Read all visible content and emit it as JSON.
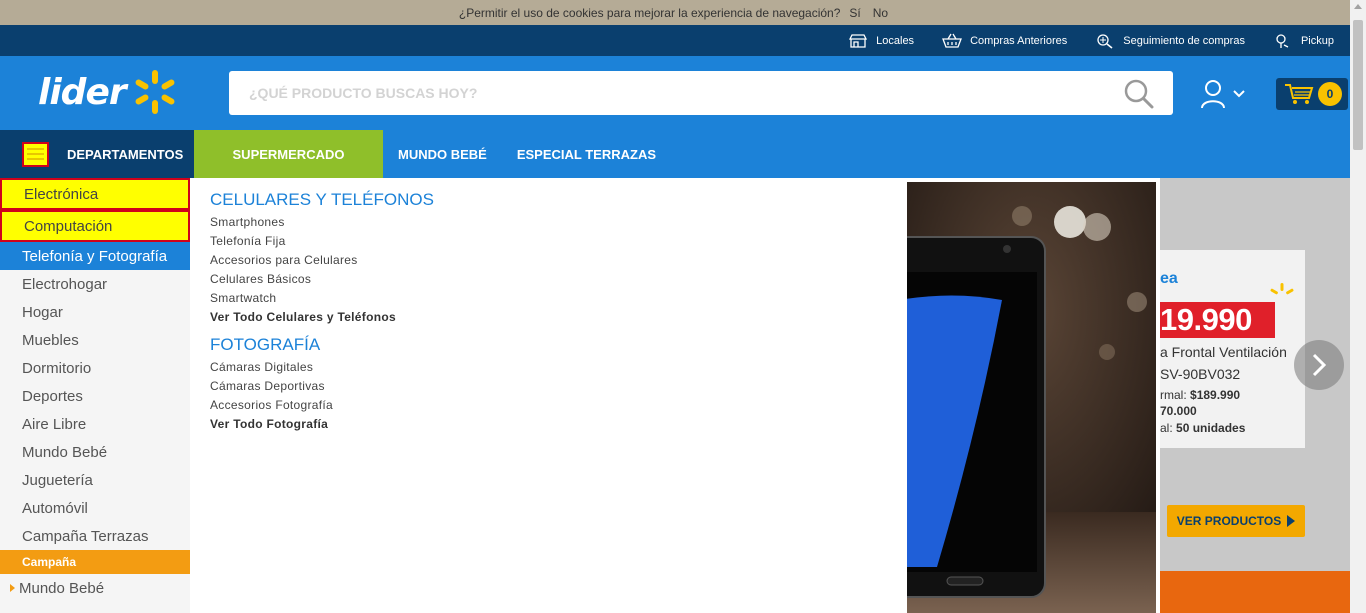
{
  "cookie": {
    "question": "¿Permitir el uso de cookies para mejorar la experiencia de navegación?",
    "yes": "Sí",
    "no": "No"
  },
  "utility": {
    "locales": "Locales",
    "compras": "Compras Anteriores",
    "seguimiento": "Seguimiento de compras",
    "pickup": "Pickup"
  },
  "header": {
    "logo": "lider",
    "search_placeholder": "¿QUÉ PRODUCTO BUSCAS HOY?",
    "cart_count": "0"
  },
  "nav": {
    "departamentos": "DEPARTAMENTOS",
    "supermercado": "SUPERMERCADO",
    "mundo_bebe": "MUNDO BEBÉ",
    "terrazas": "ESPECIAL TERRAZAS"
  },
  "sidebar": {
    "items": [
      "Electrónica",
      "Computación",
      "Telefonía y Fotografía",
      "Electrohogar",
      "Hogar",
      "Muebles",
      "Dormitorio",
      "Deportes",
      "Aire Libre",
      "Mundo Bebé",
      "Juguetería",
      "Automóvil",
      "Campaña Terrazas"
    ],
    "campaign_label": "Campaña",
    "campaign_items": [
      "Mundo Bebé"
    ]
  },
  "mega": {
    "celulares_heading": "CELULARES Y TELÉFONOS",
    "celulares_links": [
      "Smartphones",
      "Telefonía Fija",
      "Accesorios para Celulares",
      "Celulares Básicos",
      "Smartwatch"
    ],
    "celulares_all": "Ver Todo Celulares y Teléfonos",
    "foto_heading": "FOTOGRAFÍA",
    "foto_links": [
      "Cámaras Digitales",
      "Cámaras Deportivas",
      "Accesorios Fotografía"
    ],
    "foto_all": "Ver Todo Fotografía"
  },
  "hero": {
    "brand": "ea",
    "price": "19.990",
    "desc1": "a Frontal Ventilación",
    "desc2": "SV-90BV032",
    "normal_label": "rmal:",
    "normal_price": "$189.990",
    "price2": "70.000",
    "stock_label": "al:",
    "stock_value": "50 unidades",
    "cta": "VER PRODUCTOS"
  },
  "colors": {
    "brand_blue": "#1c82d8",
    "dark_blue": "#0a3f6e",
    "spark_yellow": "#f9c200",
    "super_green": "#8fbf2a",
    "campaign_orange": "#f39c12",
    "highlight_yellow": "#ffff00",
    "highlight_red": "#d0021b"
  }
}
